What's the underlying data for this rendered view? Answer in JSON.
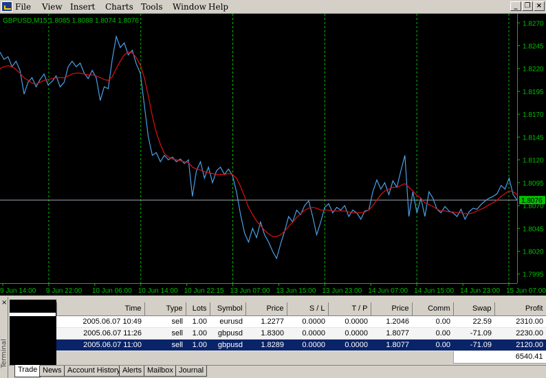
{
  "menu": {
    "items": [
      "File",
      "View",
      "Insert",
      "Charts",
      "Tools",
      "Window",
      "Help"
    ],
    "window_buttons": [
      "_",
      "❐",
      "×"
    ]
  },
  "chart": {
    "header": "GBPUSD,M15  1.8085 1.8088 1.8074 1.8076",
    "current_price": "1.8076",
    "price_labels": [
      "1.8270",
      "1.8245",
      "1.8220",
      "1.8195",
      "1.8170",
      "1.8145",
      "1.8120",
      "1.8095",
      "1.8070",
      "1.8045",
      "1.8020",
      "1.7995"
    ],
    "time_labels": [
      "9 Jun 14:00",
      "9 Jun 22:00",
      "10 Jun 06:00",
      "10 Jun 14:00",
      "10 Jun 22:15",
      "13 Jun 07:00",
      "13 Jun 15:00",
      "13 Jun 23:00",
      "14 Jun 07:00",
      "14 Jun 15:00",
      "14 Jun 23:00",
      "15 Jun 07:00"
    ],
    "colors": {
      "background": "#000000",
      "price_line": "#4aa0e8",
      "ma_line": "#e01010",
      "axis": "#00c000",
      "grid": "#00c000",
      "text": "#00c000",
      "marker_bg": "#00c000",
      "bid_line": "#a0a8b0"
    }
  },
  "chart_data": {
    "type": "line",
    "ylim": [
      1.7985,
      1.828
    ],
    "yticks": [
      1.827,
      1.8245,
      1.822,
      1.8195,
      1.817,
      1.8145,
      1.812,
      1.8095,
      1.807,
      1.8045,
      1.802,
      1.7995
    ],
    "x_labels": [
      "9 Jun 14:00",
      "9 Jun 22:00",
      "10 Jun 06:00",
      "10 Jun 14:00",
      "10 Jun 22:15",
      "13 Jun 07:00",
      "13 Jun 15:00",
      "13 Jun 23:00",
      "14 Jun 07:00",
      "14 Jun 15:00",
      "14 Jun 23:00",
      "15 Jun 07:00"
    ],
    "bid": 1.8076,
    "series": [
      {
        "values": [
          1.8238,
          1.823,
          1.8233,
          1.8222,
          1.8228,
          1.8218,
          1.8192,
          1.8205,
          1.821,
          1.82,
          1.8208,
          1.8214,
          1.8202,
          1.8206,
          1.8212,
          1.82,
          1.8205,
          1.8222,
          1.8228,
          1.8222,
          1.8226,
          1.8215,
          1.8209,
          1.8218,
          1.821,
          1.8185,
          1.82,
          1.8198,
          1.823,
          1.8255,
          1.8243,
          1.8248,
          1.8235,
          1.824,
          1.8225,
          1.8215,
          1.818,
          1.8145,
          1.8125,
          1.8128,
          1.8118,
          1.8125,
          1.812,
          1.8123,
          1.8118,
          1.8121,
          1.8116,
          1.812,
          1.808,
          1.8108,
          1.8118,
          1.81,
          1.8112,
          1.8095,
          1.8108,
          1.8112,
          1.8104,
          1.811,
          1.8103,
          1.8085,
          1.806,
          1.804,
          1.803,
          1.8045,
          1.8035,
          1.8052,
          1.8038,
          1.803,
          1.802,
          1.8012,
          1.8028,
          1.8042,
          1.8058,
          1.8052,
          1.8065,
          1.806,
          1.807,
          1.8075,
          1.8058,
          1.8038,
          1.8052,
          1.8068,
          1.8072,
          1.8062,
          1.8068,
          1.8065,
          1.807,
          1.8058,
          1.8065,
          1.8062,
          1.8055,
          1.8064,
          1.8065,
          1.8085,
          1.8098,
          1.8088,
          1.8095,
          1.8082,
          1.8097,
          1.809,
          1.8108,
          1.8125,
          1.8058,
          1.8085,
          1.8062,
          1.8078,
          1.8058,
          1.8085,
          1.8078,
          1.8066,
          1.8062,
          1.8069,
          1.8064,
          1.8062,
          1.8058,
          1.8066,
          1.8055,
          1.8063,
          1.8067,
          1.8066,
          1.8071,
          1.8075,
          1.8078,
          1.808,
          1.8083,
          1.8092,
          1.8088,
          1.81,
          1.8082,
          1.8076
        ]
      },
      {
        "values": [
          1.822,
          1.8222,
          1.8223,
          1.8222,
          1.8219,
          1.8215,
          1.821,
          1.8207,
          1.8204,
          1.8203,
          1.8205,
          1.8207,
          1.8208,
          1.8209,
          1.821,
          1.821,
          1.821,
          1.8212,
          1.8214,
          1.8215,
          1.8215,
          1.8214,
          1.8213,
          1.8213,
          1.8212,
          1.821,
          1.8208,
          1.8207,
          1.8211,
          1.822,
          1.8228,
          1.8235,
          1.8238,
          1.8237,
          1.8232,
          1.8224,
          1.821,
          1.819,
          1.8168,
          1.815,
          1.8137,
          1.8127,
          1.8123,
          1.8121,
          1.812,
          1.8119,
          1.8118,
          1.8117,
          1.8112,
          1.811,
          1.8109,
          1.8107,
          1.8106,
          1.8105,
          1.8104,
          1.8104,
          1.8104,
          1.8105,
          1.8104,
          1.81,
          1.8091,
          1.808,
          1.8068,
          1.806,
          1.8053,
          1.8048,
          1.8043,
          1.8039,
          1.8036,
          1.8036,
          1.8038,
          1.8042,
          1.8047,
          1.8052,
          1.8057,
          1.8061,
          1.8065,
          1.8067,
          1.8068,
          1.8067,
          1.8065,
          1.8065,
          1.8065,
          1.8064,
          1.8064,
          1.8064,
          1.8064,
          1.8063,
          1.8062,
          1.8062,
          1.8062,
          1.8063,
          1.8065,
          1.807,
          1.8076,
          1.8082,
          1.8086,
          1.8088,
          1.809,
          1.809,
          1.8092,
          1.8094,
          1.809,
          1.8086,
          1.8081,
          1.8078,
          1.8073,
          1.8071,
          1.8069,
          1.8066,
          1.8064,
          1.8064,
          1.8063,
          1.8063,
          1.8062,
          1.8062,
          1.8061,
          1.8061,
          1.8062,
          1.8064,
          1.8066,
          1.8068,
          1.8071,
          1.8073,
          1.8076,
          1.808,
          1.8083,
          1.8086,
          1.8085,
          1.8082
        ]
      }
    ]
  },
  "terminal": {
    "side_label": "Terminal",
    "close": "×",
    "columns": [
      "",
      "Time",
      "Type",
      "Lots",
      "Symbol",
      "Price",
      "S / L",
      "T / P",
      "Price",
      "Comm",
      "Swap",
      "Profit"
    ],
    "rows": [
      {
        "time": "2005.06.07 10:49",
        "type": "sell",
        "lots": "1.00",
        "symbol": "eurusd",
        "price": "1.2277",
        "sl": "0.0000",
        "tp": "0.0000",
        "cur": "1.2046",
        "comm": "0.00",
        "swap": "22.59",
        "profit": "2310.00"
      },
      {
        "time": "2005.06.07 11:26",
        "type": "sell",
        "lots": "1.00",
        "symbol": "gbpusd",
        "price": "1.8300",
        "sl": "0.0000",
        "tp": "0.0000",
        "cur": "1.8077",
        "comm": "0.00",
        "swap": "-71.09",
        "profit": "2230.00"
      },
      {
        "time": "2005.06.07 11:00",
        "type": "sell",
        "lots": "1.00",
        "symbol": "gbpusd",
        "price": "1.8289",
        "sl": "0.0000",
        "tp": "0.0000",
        "cur": "1.8077",
        "comm": "0.00",
        "swap": "-71.09",
        "profit": "2120.00"
      }
    ],
    "total_profit": "6540.41",
    "tabs": [
      "Trade",
      "News",
      "Account History",
      "Alerts",
      "Mailbox",
      "Journal"
    ]
  }
}
